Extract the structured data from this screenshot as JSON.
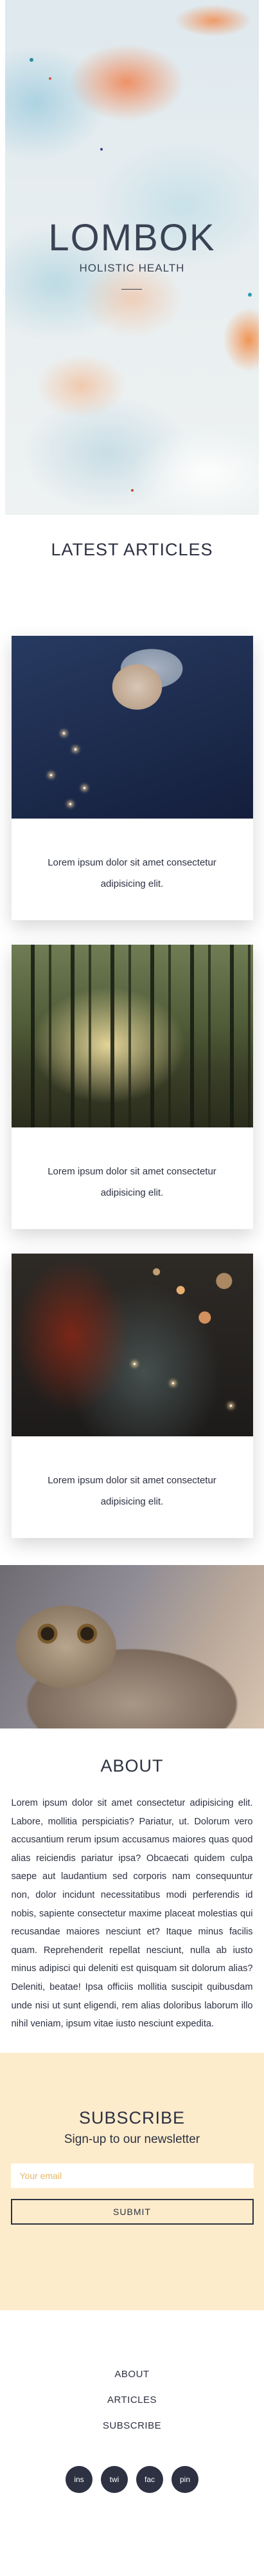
{
  "hero": {
    "title": "LOMBOK",
    "subtitle": "HOLISTIC HEALTH"
  },
  "latest": {
    "title": "LATEST ARTICLES",
    "articles": [
      {
        "image": "boy-with-sparkler-photo",
        "text": "Lorem ipsum dolor sit amet consectetur adipisicing elit."
      },
      {
        "image": "misty-forest-photo",
        "text": "Lorem ipsum dolor sit amet consectetur adipisicing elit."
      },
      {
        "image": "sparkler-bokeh-photo",
        "text": "Lorem ipsum dolor sit amet consectetur adipisicing elit."
      }
    ]
  },
  "banner": {
    "image": "tabby-cat-photo"
  },
  "about": {
    "title": "ABOUT",
    "text": "Lorem ipsum dolor sit amet consectetur adipisicing elit. Labore, mollitia perspiciatis? Pariatur, ut. Dolorum vero accusantium rerum ipsum accusamus maiores quas quod alias reiciendis pariatur ipsa? Obcaecati quidem culpa saepe aut laudantium sed corporis nam consequuntur non, dolor incidunt necessitatibus modi perferendis id nobis, sapiente consectetur maxime placeat molestias qui recusandae maiores nesciunt et? Itaque minus facilis quam. Reprehenderit repellat nesciunt, nulla ab iusto minus adipisci qui deleniti est quisquam sit dolorum alias? Deleniti, beatae! Ipsa officiis mollitia suscipit quibusdam unde nisi ut sunt eligendi, rem alias doloribus laborum illo nihil veniam, ipsum vitae iusto nesciunt expedita."
  },
  "subscribe": {
    "title": "SUBSCRIBE",
    "subtitle": "Sign-up to our newsletter",
    "email_placeholder": "Your email",
    "submit_label": "SUBMIT"
  },
  "footer": {
    "links": [
      "ABOUT",
      "ARTICLES",
      "SUBSCRIBE"
    ],
    "socials": [
      "ins",
      "twi",
      "fac",
      "pin"
    ]
  },
  "colors": {
    "text": "#2d3142",
    "subscribe_bg": "#fdeccb",
    "placeholder": "#e8b766",
    "social_bg": "#2d3142"
  }
}
